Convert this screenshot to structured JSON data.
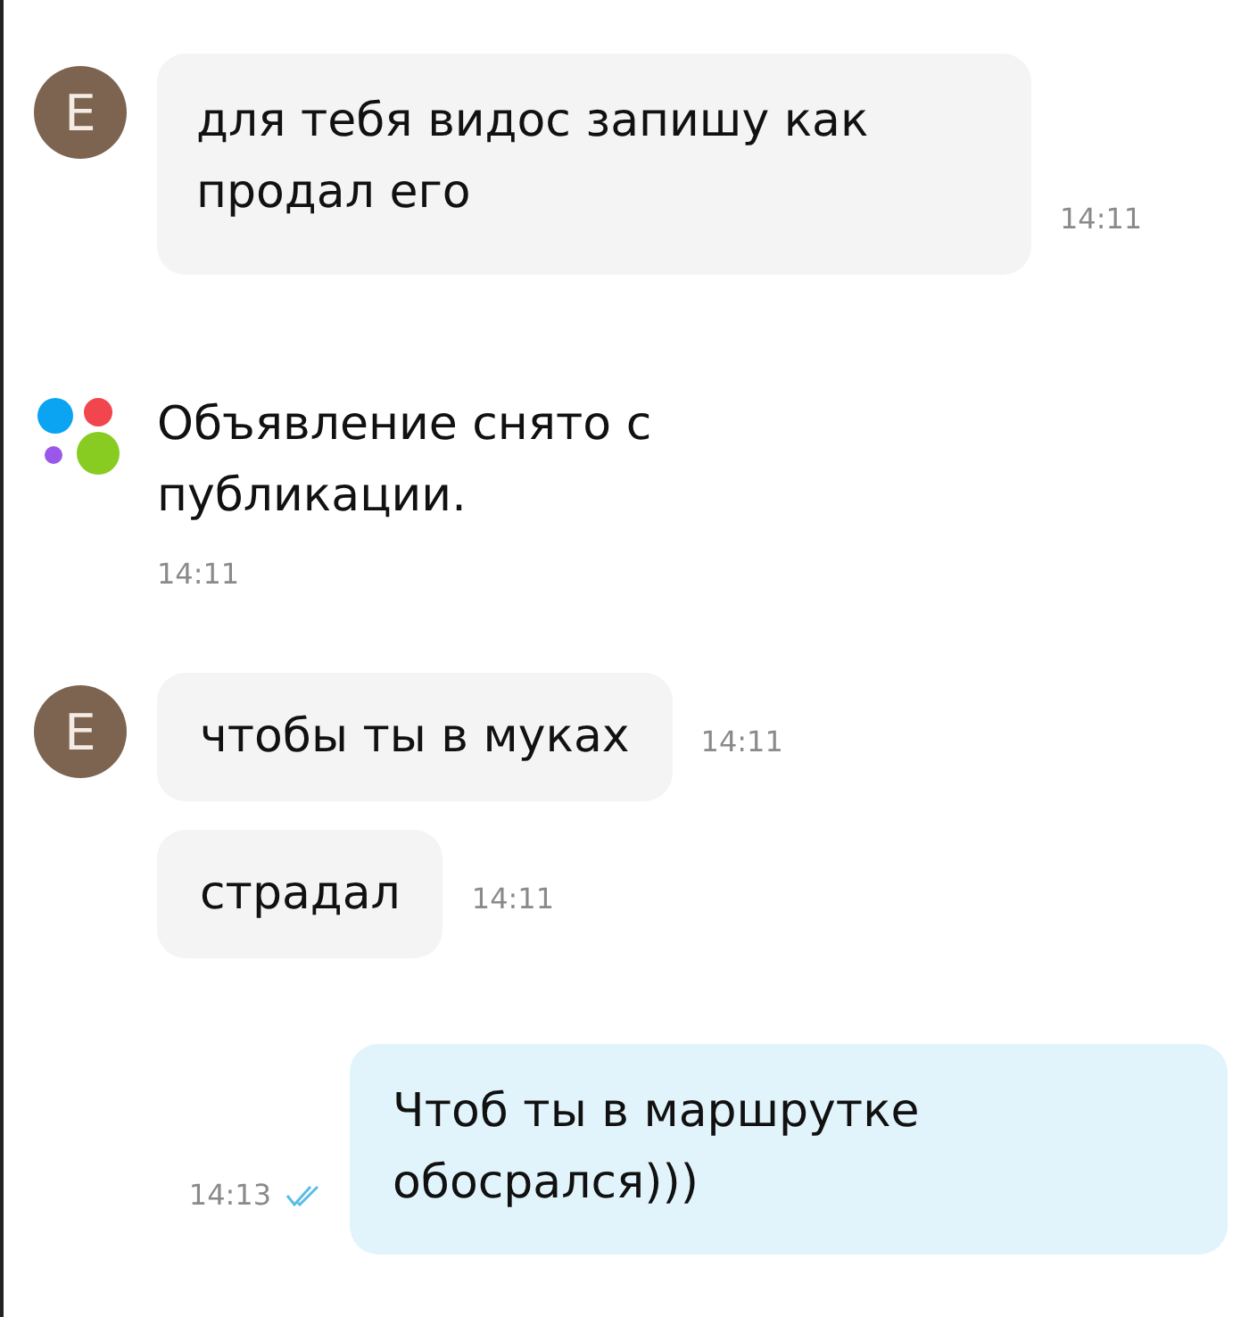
{
  "messages": [
    {
      "kind": "incoming",
      "avatar": "E",
      "text": "для тебя видос запишу как продал его",
      "time": "14:11"
    },
    {
      "kind": "system",
      "text": "Объявление снято с публикации.",
      "time": "14:11"
    },
    {
      "kind": "incoming",
      "avatar": "E",
      "text": "чтобы ты в муках",
      "time": "14:11"
    },
    {
      "kind": "incoming",
      "text": "страдал",
      "time": "14:11"
    },
    {
      "kind": "outgoing",
      "text": "Чтоб ты в маршрутке обосрался)))",
      "time": "14:13",
      "read": true
    }
  ]
}
